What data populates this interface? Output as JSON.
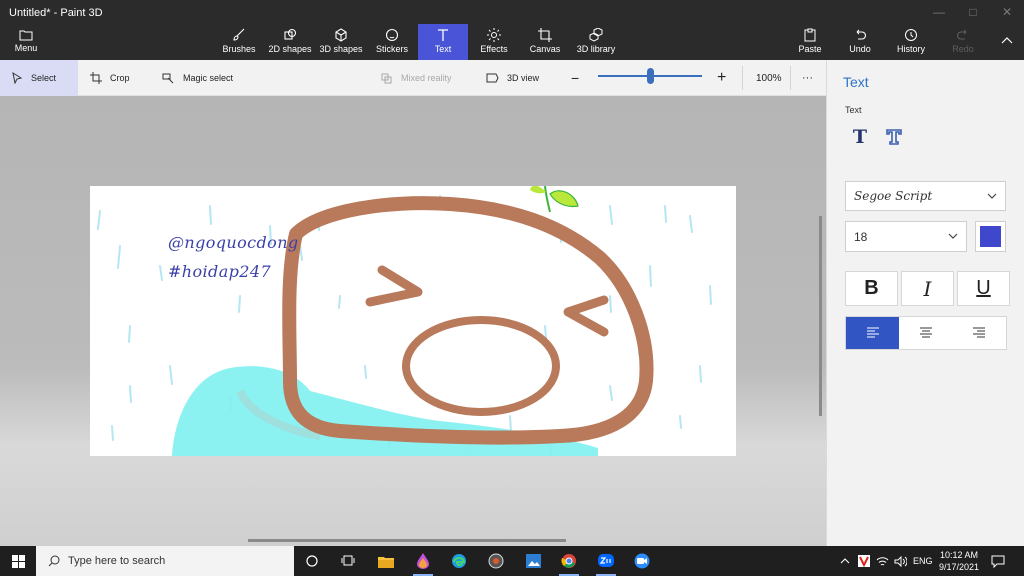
{
  "window": {
    "title": "Untitled* - Paint 3D"
  },
  "ribbon": {
    "menu_label": "Menu",
    "tools": [
      {
        "label": "Brushes",
        "icon": "brush-icon"
      },
      {
        "label": "2D shapes",
        "icon": "2d-shapes-icon"
      },
      {
        "label": "3D shapes",
        "icon": "3d-shapes-icon"
      },
      {
        "label": "Stickers",
        "icon": "stickers-icon"
      },
      {
        "label": "Text",
        "icon": "text-icon",
        "active": true
      },
      {
        "label": "Effects",
        "icon": "effects-icon"
      },
      {
        "label": "Canvas",
        "icon": "canvas-icon"
      },
      {
        "label": "3D library",
        "icon": "3d-library-icon"
      }
    ],
    "actions": [
      {
        "label": "Paste",
        "icon": "paste-icon"
      },
      {
        "label": "Undo",
        "icon": "undo-icon"
      },
      {
        "label": "History",
        "icon": "history-icon"
      },
      {
        "label": "Redo",
        "icon": "redo-icon",
        "disabled": true
      }
    ]
  },
  "commandbar": {
    "select": "Select",
    "crop": "Crop",
    "magic_select": "Magic select",
    "mixed_reality": "Mixed reality",
    "view3d": "3D view",
    "zoom_level": "100%",
    "zoom_fraction": 0.5,
    "more": "···"
  },
  "canvas": {
    "handle_text": "@ngoquocdong",
    "tag_text": "#hoidap247"
  },
  "panel": {
    "title": "Text",
    "subtitle": "Text",
    "font": "Segoe Script",
    "size": "18",
    "color": "#3f48cc",
    "bold": "B",
    "italic": "I",
    "underline": "U",
    "alignment": "left"
  },
  "taskbar": {
    "search_placeholder": "Type here to search",
    "language": "ENG",
    "time": "10:12 AM",
    "date": "9/17/2021"
  },
  "colors": {
    "accent": "#4a54d6",
    "ribbon_bg": "#2b2b2b",
    "drawing_brown": "#b87a5a",
    "text_blue": "#3b40a8"
  }
}
